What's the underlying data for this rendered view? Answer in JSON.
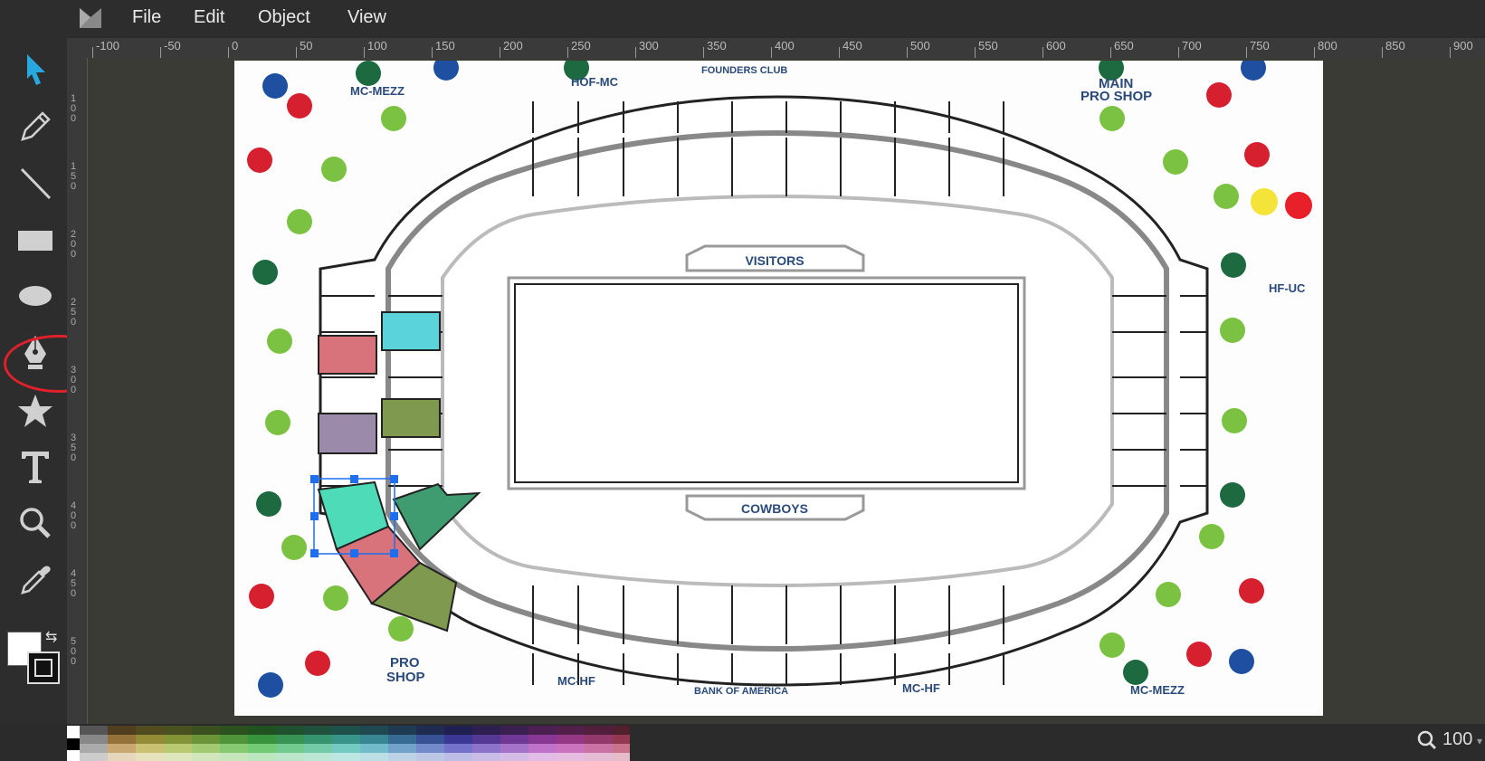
{
  "menu": {
    "items": [
      {
        "label": "File"
      },
      {
        "label": "Edit"
      },
      {
        "label": "Object"
      },
      {
        "label": "View"
      }
    ]
  },
  "toolbar": {
    "tools": [
      {
        "name": "select",
        "icon": "pointer-arrow-icon"
      },
      {
        "name": "pencil",
        "icon": "pencil-icon"
      },
      {
        "name": "line",
        "icon": "line-icon"
      },
      {
        "name": "rectangle",
        "icon": "rectangle-icon"
      },
      {
        "name": "ellipse",
        "icon": "ellipse-icon"
      },
      {
        "name": "pen",
        "icon": "pen-nib-icon",
        "highlighted": true
      },
      {
        "name": "star",
        "icon": "star-icon"
      },
      {
        "name": "text",
        "icon": "text-icon"
      },
      {
        "name": "zoom",
        "icon": "magnifier-icon"
      },
      {
        "name": "eyedropper",
        "icon": "eyedropper-icon"
      }
    ],
    "fill_color": "#ffffff",
    "stroke_color": "#111111",
    "accent_color": "#29a8e0"
  },
  "ruler": {
    "labels": [
      "-100",
      "-50",
      "0",
      "50",
      "100",
      "150",
      "200",
      "250",
      "300",
      "350",
      "400",
      "450",
      "500",
      "550",
      "600",
      "650",
      "700",
      "750",
      "800",
      "850",
      "900"
    ],
    "vertical_labels": [
      "100",
      "150",
      "200",
      "250",
      "300",
      "350",
      "400",
      "450",
      "500"
    ]
  },
  "map": {
    "labels": {
      "visitors": "VISITORS",
      "cowboys": "COWBOYS",
      "mc_mezz_top": "MC-MEZZ",
      "hof_mc": "HOF-MC",
      "founders_club": "FOUNDERS CLUB",
      "main": "MAIN",
      "pro_shop_top": "PRO SHOP",
      "hf_uc": "HF-UC",
      "pro": "PRO",
      "shop": "SHOP",
      "mc_hf": "MC-HF",
      "bank_of_america": "BANK OF AMERICA",
      "mc_hf2": "MC-HF",
      "mc_mezz_bottom": "MC-MEZZ"
    },
    "colors": {
      "red_section": "#d8737b",
      "cyan_section": "#5ad3db",
      "olive_section": "#7f9a4e",
      "purple_section": "#9b8aaa",
      "teal_selected": "#4ddbb8",
      "green_section": "#3f9b70",
      "selection": "#1e6ff0"
    }
  },
  "status": {
    "zoom": "100"
  }
}
